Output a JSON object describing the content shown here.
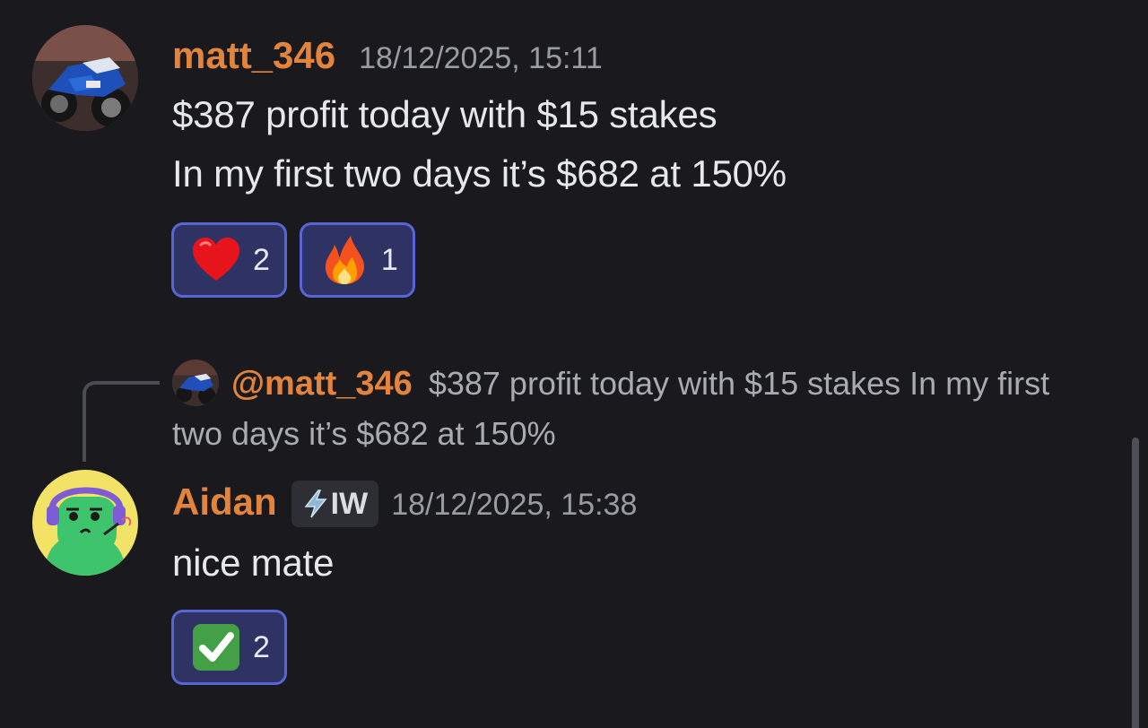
{
  "messages": [
    {
      "author": "matt_346",
      "timestamp": "18/12/2025, 15:11",
      "avatar_icon": "motorcycle-avatar",
      "lines": [
        "$387 profit today with $15 stakes",
        "In my first two days it’s $682 at 150%"
      ],
      "reactions": [
        {
          "emoji": "heart-icon",
          "count": "2"
        },
        {
          "emoji": "fire-icon",
          "count": "1"
        }
      ]
    },
    {
      "reply_to": {
        "mention": "@matt_346",
        "text": "$387 profit today with $15 stakes In my first two days it’s $682 at 150%"
      },
      "author": "Aidan",
      "tag": "IW",
      "tag_icon": "lightning-icon",
      "timestamp": "18/12/2025, 15:38",
      "avatar_icon": "green-character-avatar",
      "lines": [
        "nice mate"
      ],
      "reactions": [
        {
          "emoji": "check-mark-icon",
          "count": "2"
        }
      ]
    }
  ],
  "colors": {
    "background": "#1a1a1e",
    "username": "#e3843c",
    "reaction_bg": "#2f3364",
    "reaction_border": "#5865d6"
  }
}
